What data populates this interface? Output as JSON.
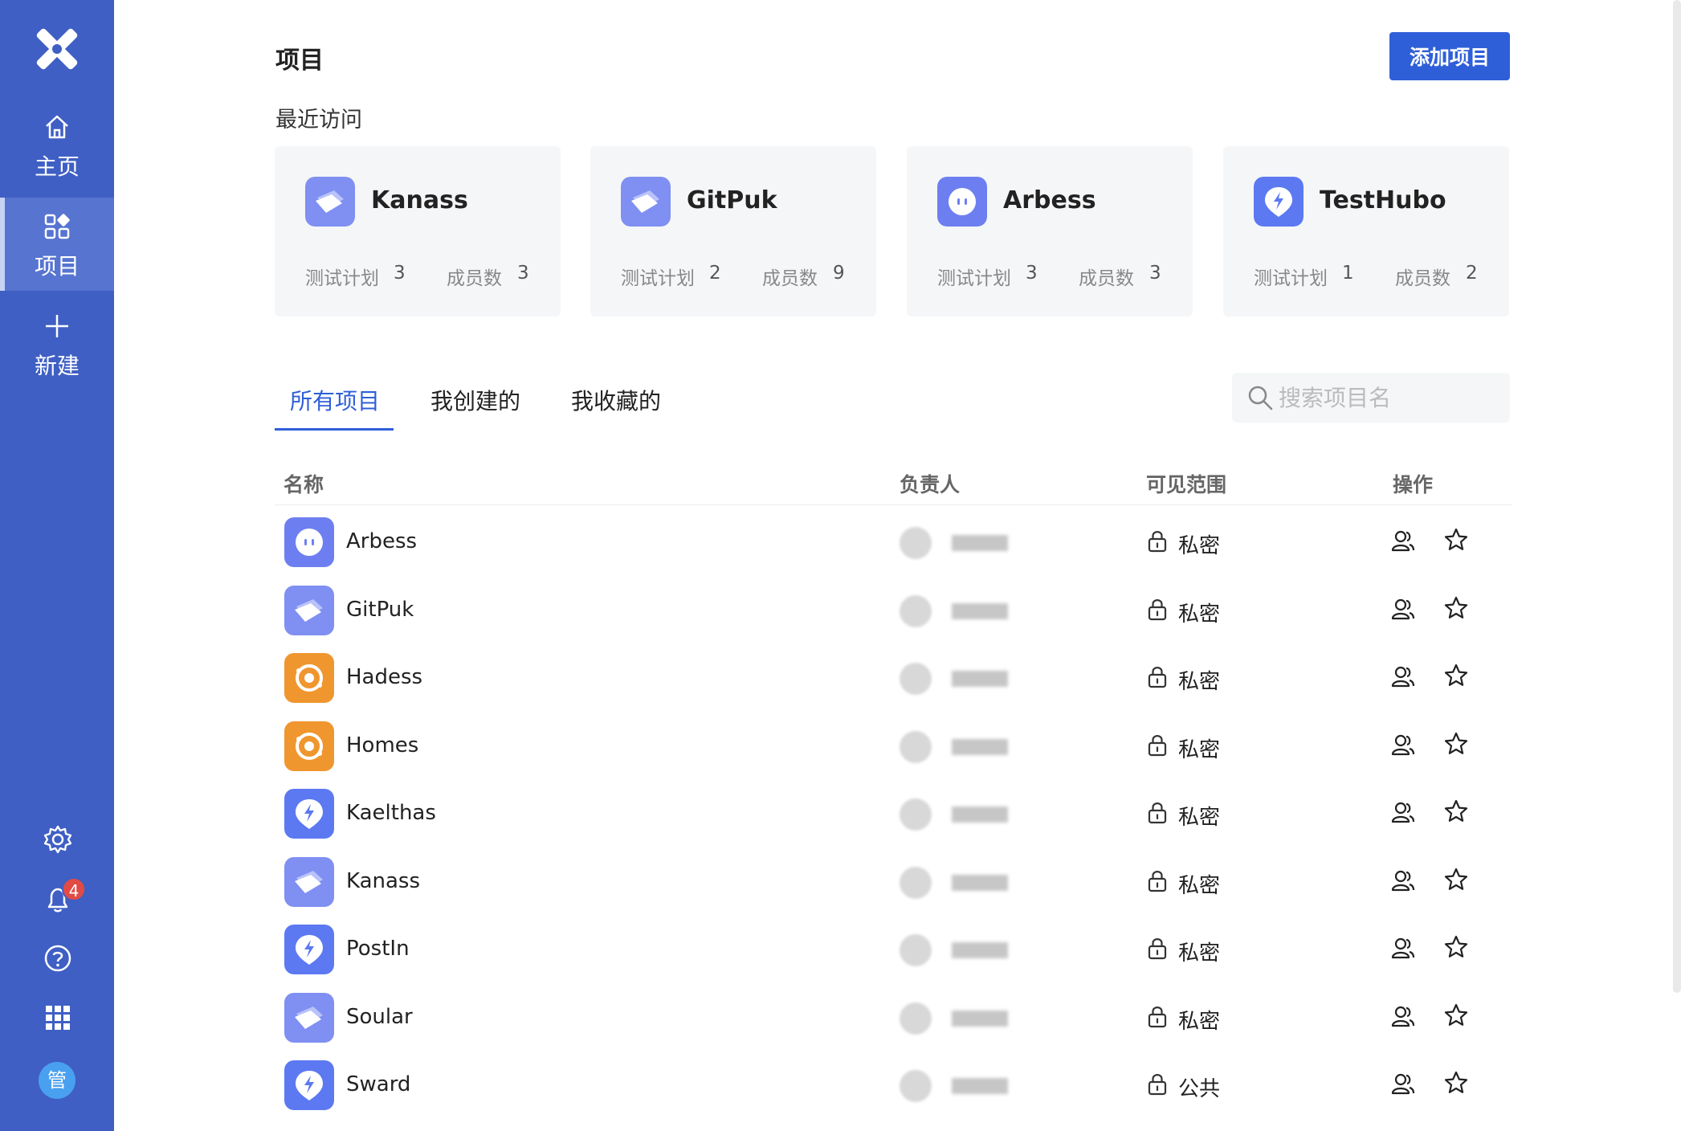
{
  "sidebar": {
    "items": [
      {
        "label": "主页",
        "icon": "home-icon"
      },
      {
        "label": "项目",
        "icon": "grid-icon",
        "active": true
      },
      {
        "label": "新建",
        "icon": "plus-icon"
      }
    ],
    "bottom_icons": [
      "settings-icon",
      "bell-icon",
      "help-icon",
      "apps-icon"
    ],
    "notification_count": "4",
    "avatar_text": "管",
    "accent": "#3f5fc4"
  },
  "header": {
    "title": "项目",
    "add_button": "添加项目"
  },
  "recent": {
    "title": "最近访问",
    "cards": [
      {
        "name": "Kanass",
        "icon": "kanass-icon",
        "plan_label": "测试计划",
        "plan_count": "3",
        "member_label": "成员数",
        "member_count": "3"
      },
      {
        "name": "GitPuk",
        "icon": "kanass-icon",
        "plan_label": "测试计划",
        "plan_count": "2",
        "member_label": "成员数",
        "member_count": "9"
      },
      {
        "name": "Arbess",
        "icon": "arbess-icon",
        "plan_label": "测试计划",
        "plan_count": "3",
        "member_label": "成员数",
        "member_count": "3"
      },
      {
        "name": "TestHubo",
        "icon": "bolt-pin-icon",
        "plan_label": "测试计划",
        "plan_count": "1",
        "member_label": "成员数",
        "member_count": "2"
      }
    ]
  },
  "tabs": [
    {
      "label": "所有项目",
      "active": true
    },
    {
      "label": "我创建的"
    },
    {
      "label": "我收藏的"
    }
  ],
  "search": {
    "placeholder": "搜索项目名"
  },
  "table": {
    "columns": [
      "名称",
      "负责人",
      "可见范围",
      "操作"
    ],
    "rows": [
      {
        "name": "Arbess",
        "icon": "arbess-icon",
        "visibility": "私密"
      },
      {
        "name": "GitPuk",
        "icon": "kanass-icon",
        "visibility": "私密"
      },
      {
        "name": "Hadess",
        "icon": "hadess-icon",
        "visibility": "私密"
      },
      {
        "name": "Homes",
        "icon": "hadess-icon",
        "visibility": "私密"
      },
      {
        "name": "Kaelthas",
        "icon": "bolt-pin-icon",
        "visibility": "私密"
      },
      {
        "name": "Kanass",
        "icon": "kanass-icon",
        "visibility": "私密"
      },
      {
        "name": "PostIn",
        "icon": "bolt-pin-icon",
        "visibility": "私密"
      },
      {
        "name": "Soular",
        "icon": "kanass-icon",
        "visibility": "私密"
      },
      {
        "name": "Sward",
        "icon": "bolt-pin-icon",
        "visibility": "公共"
      }
    ]
  },
  "colors": {
    "primary": "#2f5fd8",
    "purple_icon": "#7c8cf0",
    "blue_icon": "#5b7bf0",
    "orange_icon": "#f0962e"
  }
}
